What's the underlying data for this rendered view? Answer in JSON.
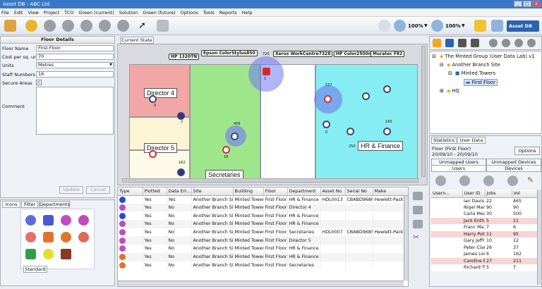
{
  "window": {
    "title": "Asset DB - ABC Ltd"
  },
  "menu": [
    "File",
    "Edit",
    "View",
    "Project",
    "TCO",
    "Green (current)",
    "Solution",
    "Green (future)",
    "Options",
    "Tools",
    "Reports",
    "Help"
  ],
  "toolbar": {
    "zoom1": "100%",
    "zoom2": "100%",
    "brand": "Asset DB"
  },
  "floor_details": {
    "title": "Floor Details",
    "floor_name_label": "Floor Name",
    "floor_name": "First Floor",
    "cost_label": "Cost per sq. unit",
    "cost": "70",
    "units_label": "Units",
    "units": "Metres",
    "staff_label": "Staff Numbers",
    "staff": "16",
    "secure_label": "Secure Areas",
    "comment_label": "Comment",
    "update_button": "Update",
    "cancel_button": "Cancel"
  },
  "icons_panel": {
    "tabs": [
      "Icons",
      "Filter",
      "Departments"
    ],
    "bottom_tab": "Standard"
  },
  "map": {
    "tab": "Current State",
    "rooms": {
      "d4": "Director 4",
      "d5": "Director 5",
      "sec": "Secretaries",
      "hr": "HR & Finance"
    },
    "callouts": [
      "HP 1320TN",
      "Epson ColorStylus850",
      "Xerox WorkCentre7328",
      "HP Color2500n",
      "Muratec F82"
    ],
    "counts": [
      "720",
      "1",
      "9",
      "7",
      "537",
      "0",
      "456",
      "18",
      "160",
      "250",
      "162"
    ]
  },
  "grid": {
    "columns": [
      "Type",
      "Plotted",
      "Data Err...",
      "Site",
      "Building",
      "Floor",
      "Department",
      "Asset No",
      "Serial No",
      "Make"
    ],
    "rows": [
      [
        "Yes",
        "Yes",
        "Another Branch Site",
        "Minted Towers",
        "First Floor",
        "HR & Finance",
        "HDL0013",
        "CBABD96864",
        "Hewlett-Packard"
      ],
      [
        "Yes",
        "No",
        "Another Branch Site",
        "Minted Towers",
        "First Floor",
        "Director 4",
        "",
        "",
        ""
      ],
      [
        "Yes",
        "No",
        "Another Branch Site",
        "Minted Towers",
        "First Floor",
        "HR & Finance",
        "",
        "",
        ""
      ],
      [
        "Yes",
        "No",
        "Another Branch Site",
        "Minted Towers",
        "First Floor",
        "HR & Finance",
        "",
        "",
        ""
      ],
      [
        "Yes",
        "No",
        "Another Branch Site",
        "Minted Towers",
        "First Floor",
        "Secretaries",
        "HDL0007",
        "CBABD96859",
        "Hewlett-Packard"
      ],
      [
        "Yes",
        "No",
        "Another Branch Site",
        "Minted Towers",
        "First Floor",
        "Director 5",
        "",
        "",
        ""
      ],
      [
        "Yes",
        "No",
        "Another Branch Site",
        "Minted Towers",
        "First Floor",
        "HR & Finance",
        "",
        "",
        ""
      ],
      [
        "Yes",
        "No",
        "Another Branch Site",
        "Minted Towers",
        "First Floor",
        "HR & Finance",
        "",
        "",
        ""
      ],
      [
        "Yes",
        "No",
        "Another Branch Site",
        "Minted Towers",
        "First Floor",
        "Secretaries",
        "",
        "",
        ""
      ]
    ]
  },
  "tree": {
    "items": [
      "The Minted Group (User Data Lab) v1",
      "Another Branch Site",
      "Minted Towers",
      "First Floor",
      "HQ"
    ]
  },
  "right_panel": {
    "tabs": [
      "Statistics",
      "User Data"
    ],
    "floor_line1": "Floor (First Floor)",
    "floor_line2": "20/09/10 - 20/09/10",
    "options_button": "Options",
    "subtabs": [
      "Unmapped Users",
      "Unmapped Devices",
      "Users",
      "Devices"
    ],
    "user_columns": [
      "Usern...",
      "User ID",
      "Jobs",
      "Vol"
    ],
    "users": [
      [
        "Ian Davis",
        "22",
        "465"
      ],
      [
        "Nigel Mansell",
        "90",
        "90"
      ],
      [
        "Carla Meads",
        "30",
        "500"
      ],
      [
        "Jack Enth...",
        "5",
        "11"
      ],
      [
        "Franc Ma...",
        "7",
        "6"
      ],
      [
        "Harry Potter",
        "11",
        "95"
      ],
      [
        "Gary Jeffrey",
        "10",
        "12"
      ],
      [
        "Peter Clarke",
        "26",
        "37"
      ],
      [
        "James Long",
        "6",
        "162"
      ],
      [
        "Caroline E...",
        "27",
        "211"
      ],
      [
        "Richard Ty...",
        "5",
        "7"
      ]
    ]
  }
}
